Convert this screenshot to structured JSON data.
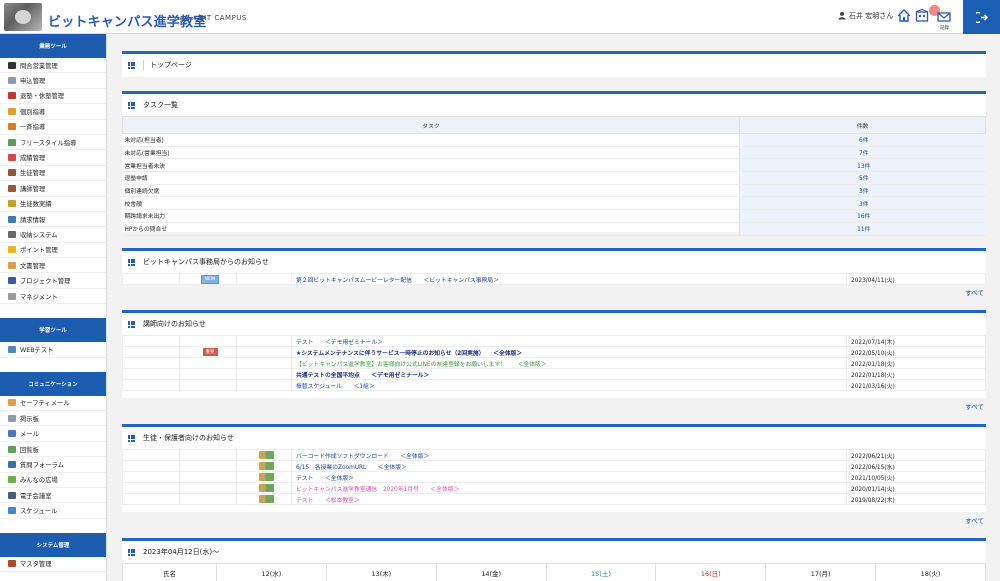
{
  "header": {
    "brand": "ビットキャンパス進学教室",
    "powered": "powered by",
    "company": "BIT CAMPUS",
    "user": "石井 宏明さん",
    "mail_caption": "記録"
  },
  "sidebar": {
    "sections": [
      {
        "title": "業務ツール",
        "items": [
          {
            "label": "問合営業管理",
            "color": "#333333"
          },
          {
            "label": "申込管理",
            "color": "#8a9bb7"
          },
          {
            "label": "退塾・休塾管理",
            "color": "#c0392b"
          },
          {
            "label": "個別指導",
            "color": "#e0a030"
          },
          {
            "label": "一斉指導",
            "color": "#e07a20"
          },
          {
            "label": "フリースタイル指導",
            "color": "#5a9a5a"
          },
          {
            "label": "成績管理",
            "color": "#d04a4a"
          },
          {
            "label": "生徒管理",
            "color": "#8a5a3a"
          },
          {
            "label": "講師管理",
            "color": "#9a5a3a"
          },
          {
            "label": "生徒数実績",
            "color": "#c8a020"
          },
          {
            "label": "請求情報",
            "color": "#3a7ac0"
          },
          {
            "label": "収納システム",
            "color": "#6a6a6a"
          },
          {
            "label": "ポイント管理",
            "color": "#e8b820"
          },
          {
            "label": "文書管理",
            "color": "#d8a050"
          },
          {
            "label": "プロジェクト管理",
            "color": "#3a5aa0"
          },
          {
            "label": "マネジメント",
            "color": "#9a9a9a"
          }
        ]
      },
      {
        "title": "学習ツール",
        "items": [
          {
            "label": "WEBテスト",
            "color": "#4a8ac0"
          }
        ]
      },
      {
        "title": "コミュニケーション",
        "items": [
          {
            "label": "セーフティメール",
            "color": "#e0a040"
          },
          {
            "label": "掲示板",
            "color": "#8a9ab0"
          },
          {
            "label": "メール",
            "color": "#4a7ac0"
          },
          {
            "label": "回覧板",
            "color": "#5aa05a"
          },
          {
            "label": "質問フォーラム",
            "color": "#3a6ab0"
          },
          {
            "label": "みんなの広場",
            "color": "#6ab04a"
          },
          {
            "label": "電子会議室",
            "color": "#4a5a7a"
          },
          {
            "label": "スケジュール",
            "color": "#3a8ad0"
          }
        ]
      },
      {
        "title": "システム管理",
        "items": [
          {
            "label": "マスタ管理",
            "color": "#b04a2a"
          }
        ]
      }
    ]
  },
  "main": {
    "top_title": "トップページ",
    "tasks": {
      "title": "タスク一覧",
      "col_task": "タスク",
      "col_count": "件数",
      "rows": [
        {
          "task": "未対応(担当者)",
          "count": "6件"
        },
        {
          "task": "未対応(営業担当)",
          "count": "7件"
        },
        {
          "task": "営業担当者未決",
          "count": "13件"
        },
        {
          "task": "退塾申請",
          "count": "5件"
        },
        {
          "task": "個別連続欠席",
          "count": "3件"
        },
        {
          "task": "校舎顔",
          "count": "3件"
        },
        {
          "task": "期跨請求未出力",
          "count": "16件"
        },
        {
          "task": "HPからの問合せ",
          "count": "11件"
        }
      ]
    },
    "office_notice": {
      "title": "ビットキャンパス事務局からのお知らせ",
      "more": "すべて",
      "rows": [
        {
          "badge": "NEW",
          "text": "第２回ビットキャンパスムービーレター配信　　＜ビットキャンパス事務局＞",
          "date": "2023/04/11(火)"
        }
      ]
    },
    "teacher_notice": {
      "title": "講師向けのお知らせ",
      "more": "すべて",
      "rows": [
        {
          "badge": "",
          "text": "テスト　　＜デモ用ゼミナール＞",
          "date": "2022/07/14(木)",
          "style": "normal"
        },
        {
          "badge": "重要",
          "text": "★システムメンテナンスに伴うサービス一時停止のお知らせ（2回実施）　　＜全体版＞",
          "date": "2022/05/10(火)",
          "style": "bold"
        },
        {
          "badge": "",
          "text": "【ビットキャンパス進学教室】お客様向け公式LINEの友達登録をお願いします！　　＜全体版＞",
          "date": "2022/01/18(火)",
          "style": "green"
        },
        {
          "badge": "",
          "text": "共通テストの全国平均点　　＜デモ用ゼミナール＞",
          "date": "2022/01/18(火)",
          "style": "bold"
        },
        {
          "badge": "",
          "text": "振替スケジュール　　＜1組＞",
          "date": "2021/03/16(火)",
          "style": "normal"
        }
      ]
    },
    "parent_notice": {
      "title": "生徒・保護者向けのお知らせ",
      "more": "すべて",
      "rows": [
        {
          "text": "バーコード作成ソフトダウンロード　　＜全体版＞",
          "date": "2022/06/21(火)",
          "style": "normal"
        },
        {
          "text": "6/15　各授業のZoomURL　　＜全体版＞",
          "date": "2022/06/15(水)",
          "style": "normal"
        },
        {
          "text": "テスト　　＜全体版＞",
          "date": "2021/10/05(火)",
          "style": "normal"
        },
        {
          "text": "ビットキャンパス進学教室通信　2020年1月号　　＜全体版＞",
          "date": "2020/01/14(火)",
          "style": "pink"
        },
        {
          "text": "テスト　　＜松本教室＞",
          "date": "2019/08/22(木)",
          "style": "pink"
        }
      ]
    },
    "calendar": {
      "title": "2023年04月12日(水)〜",
      "name_col": "氏名",
      "days": [
        {
          "label": "12(水)",
          "color": "#222222"
        },
        {
          "label": "13(木)",
          "color": "#222222"
        },
        {
          "label": "14(金)",
          "color": "#222222"
        },
        {
          "label": "15(土)",
          "color": "#2a7ad0"
        },
        {
          "label": "16(日)",
          "color": "#d03030"
        },
        {
          "label": "17(月)",
          "color": "#222222"
        },
        {
          "label": "18(火)",
          "color": "#222222"
        }
      ]
    }
  }
}
